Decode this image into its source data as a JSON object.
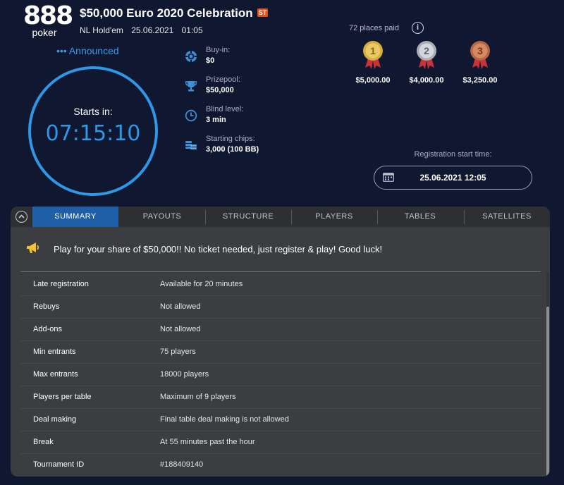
{
  "brand": {
    "logo_number": "888",
    "logo_word": "poker"
  },
  "tournament": {
    "title": "$50,000 Euro 2020 Celebration",
    "badge": "ST",
    "game": "NL Hold'em",
    "date": "25.06.2021",
    "time": "01:05"
  },
  "clock": {
    "status": "••• Announced",
    "label": "Starts in:",
    "countdown": "07:15:10"
  },
  "info": [
    {
      "label": "Buy-in:",
      "value": "$0",
      "icon": "poker-chip-icon"
    },
    {
      "label": "Prizepool:",
      "value": "$50,000",
      "icon": "trophy-icon"
    },
    {
      "label": "Blind level:",
      "value": "3 min",
      "icon": "clock-icon"
    },
    {
      "label": "Starting chips:",
      "value": "3,000 (100 BB)",
      "icon": "chips-stack-icon"
    }
  ],
  "places": {
    "text": "72 places paid",
    "info_symbol": "i",
    "medals": [
      {
        "rank": "1",
        "amount": "$5,000.00",
        "color": "#d6ac3c"
      },
      {
        "rank": "2",
        "amount": "$4,000.00",
        "color": "#b7bcc4"
      },
      {
        "rank": "3",
        "amount": "$3,250.00",
        "color": "#c0704a"
      }
    ]
  },
  "registration": {
    "label": "Registration start time:",
    "value": "25.06.2021 12:05"
  },
  "tabs": [
    "SUMMARY",
    "PAYOUTS",
    "STRUCTURE",
    "PLAYERS",
    "TABLES",
    "SATELLITES"
  ],
  "summary": {
    "banner": "Play for your share of $50,000!! No ticket needed, just register & play! Good luck!",
    "rows": [
      {
        "key": "Late registration",
        "value": "Available for 20 minutes"
      },
      {
        "key": "Rebuys",
        "value": "Not allowed"
      },
      {
        "key": "Add-ons",
        "value": "Not allowed"
      },
      {
        "key": "Min entrants",
        "value": "75 players"
      },
      {
        "key": "Max entrants",
        "value": "18000 players"
      },
      {
        "key": "Players per table",
        "value": "Maximum of 9 players"
      },
      {
        "key": "Deal making",
        "value": "Final table deal making is not allowed"
      },
      {
        "key": "Break",
        "value": "At 55 minutes past the hour"
      },
      {
        "key": "Tournament ID",
        "value": "#188409140"
      }
    ]
  },
  "colors": {
    "background": "#0f1830",
    "accent": "#2e97e6",
    "active_tab": "#1f5fa8",
    "panel": "#3b3d40"
  }
}
